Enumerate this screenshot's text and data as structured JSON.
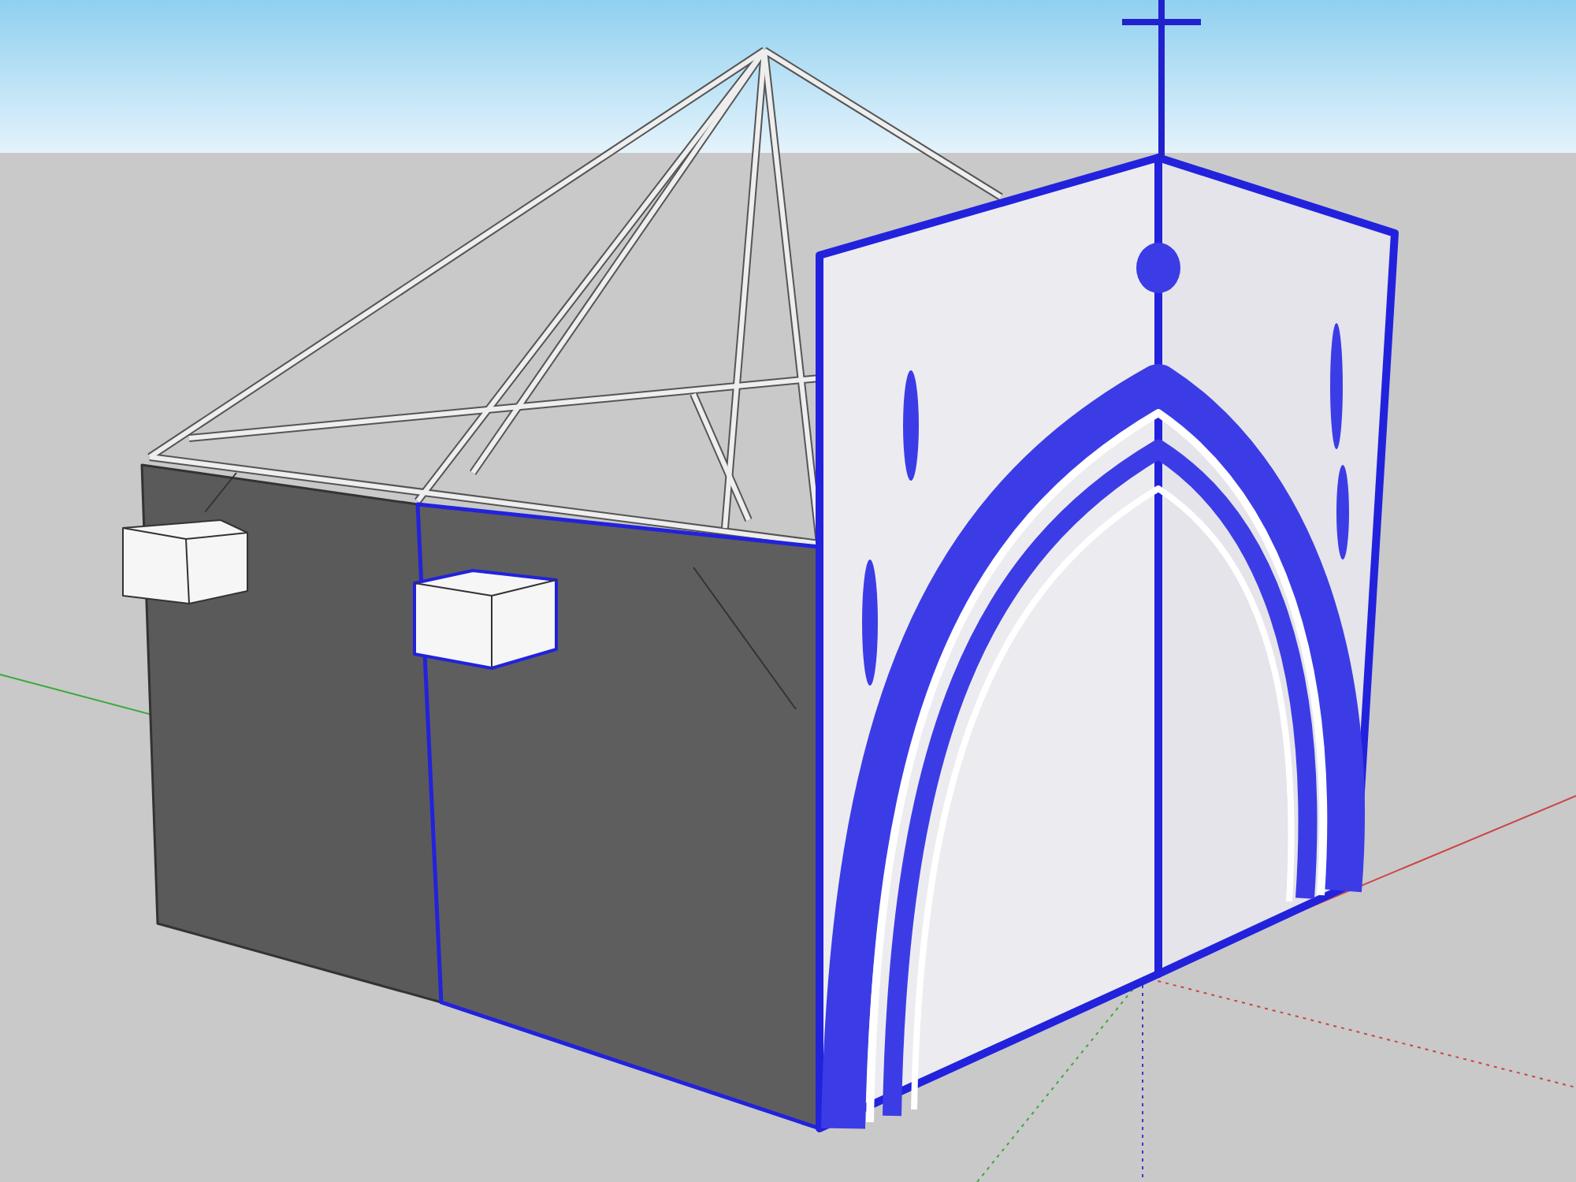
{
  "viewport": {
    "show_axes": true
  }
}
